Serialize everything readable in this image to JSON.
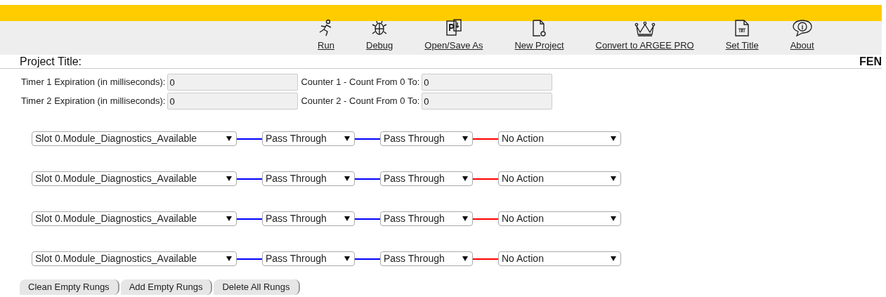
{
  "toolbar": [
    {
      "kind": "run",
      "label": "Run"
    },
    {
      "kind": "debug",
      "label": "Debug"
    },
    {
      "kind": "open",
      "label": "Open/Save As"
    },
    {
      "kind": "new",
      "label": "New Project"
    },
    {
      "kind": "crown",
      "label": "Convert to ARGEE PRO"
    },
    {
      "kind": "title",
      "label": "Set Title"
    },
    {
      "kind": "about",
      "label": "About"
    }
  ],
  "project_title": {
    "label": "Project Title:",
    "badge": "FEN"
  },
  "settings": [
    {
      "label": "Timer 1 Expiration (in milliseconds):",
      "value": "0"
    },
    {
      "label": "Counter 1 - Count From 0 To:",
      "value": "0"
    },
    {
      "label": "Timer 2 Expiration (in milliseconds):",
      "value": "0"
    },
    {
      "label": "Counter 2 - Count From 0 To:",
      "value": "0"
    }
  ],
  "rungs": [
    {
      "condition": "Slot 0.Module_Diagnostics_Available",
      "stage_1": "Pass Through",
      "stage_2": "Pass Through",
      "action": "No Action",
      "connectors": [
        {
          "color": "#0000ff"
        },
        {
          "color": "#0000ff"
        },
        {
          "color": "#ff0000"
        }
      ]
    },
    {
      "condition": "Slot 0.Module_Diagnostics_Available",
      "stage_1": "Pass Through",
      "stage_2": "Pass Through",
      "action": "No Action",
      "connectors": [
        {
          "color": "#0000ff"
        },
        {
          "color": "#0000ff"
        },
        {
          "color": "#ff0000"
        }
      ]
    },
    {
      "condition": "Slot 0.Module_Diagnostics_Available",
      "stage_1": "Pass Through",
      "stage_2": "Pass Through",
      "action": "No Action",
      "connectors": [
        {
          "color": "#0000ff"
        },
        {
          "color": "#0000ff"
        },
        {
          "color": "#ff0000"
        }
      ]
    },
    {
      "condition": "Slot 0.Module_Diagnostics_Available",
      "stage_1": "Pass Through",
      "stage_2": "Pass Through",
      "action": "No Action",
      "connectors": [
        {
          "color": "#0000ff"
        },
        {
          "color": "#0000ff"
        },
        {
          "color": "#ff0000"
        }
      ]
    }
  ],
  "buttons": [
    "Clean Empty Rungs",
    "Add Empty Rungs",
    "Delete All Rungs"
  ]
}
